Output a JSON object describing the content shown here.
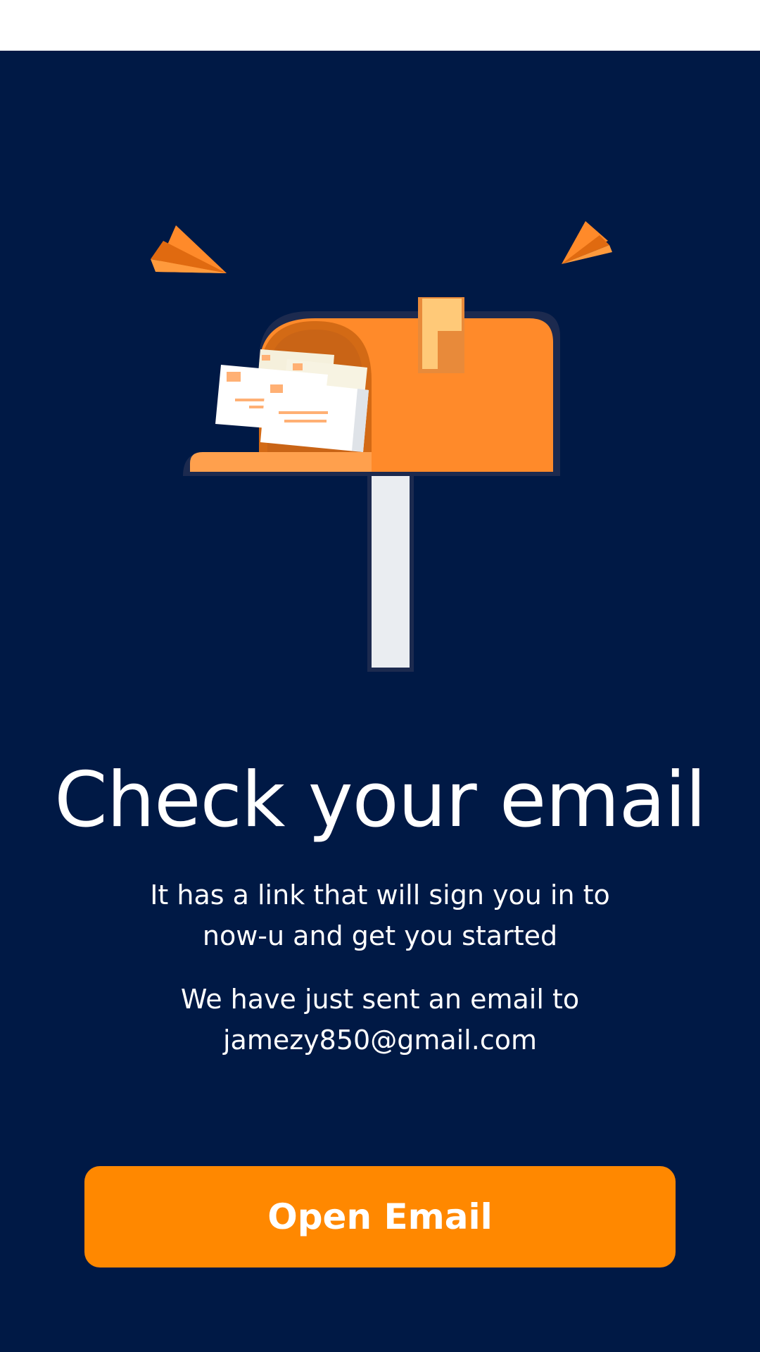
{
  "screen": {
    "title": "Check your email",
    "message_line_1": "It has a link that will sign you in to",
    "message_line_2": "now-u and get you started",
    "sent_line_1": "We have just sent an email to",
    "sent_email": "jamezy850@gmail.com",
    "open_email_label": "Open Email"
  },
  "theme": {
    "background": "#001945",
    "accent": "#ff8800",
    "text": "#ffffff"
  },
  "illustration": {
    "subject": "mailbox-with-letters",
    "decorations": [
      "paper-plane-icon",
      "paper-plane-icon"
    ]
  }
}
